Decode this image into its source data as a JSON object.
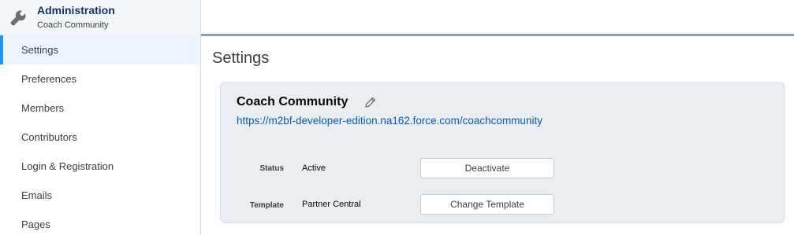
{
  "sidebar": {
    "header": {
      "title": "Administration",
      "subtitle": "Coach Community",
      "icon": "wrench-icon"
    },
    "items": [
      {
        "label": "Settings",
        "active": true
      },
      {
        "label": "Preferences",
        "active": false
      },
      {
        "label": "Members",
        "active": false
      },
      {
        "label": "Contributors",
        "active": false
      },
      {
        "label": "Login & Registration",
        "active": false
      },
      {
        "label": "Emails",
        "active": false
      },
      {
        "label": "Pages",
        "active": false
      }
    ]
  },
  "main": {
    "page_title": "Settings",
    "card": {
      "community_name": "Coach Community",
      "url": "https://m2bf-developer-edition.na162.force.com/coachcommunity",
      "rows": {
        "status": {
          "label": "Status",
          "value": "Active",
          "button": "Deactivate"
        },
        "template": {
          "label": "Template",
          "value": "Partner Central",
          "button": "Change Template"
        }
      }
    }
  },
  "colors": {
    "accent": "#1b96ff",
    "link": "#0b5cab",
    "card_bg": "#eaeef3",
    "active_item_bg": "#eef4ff"
  }
}
